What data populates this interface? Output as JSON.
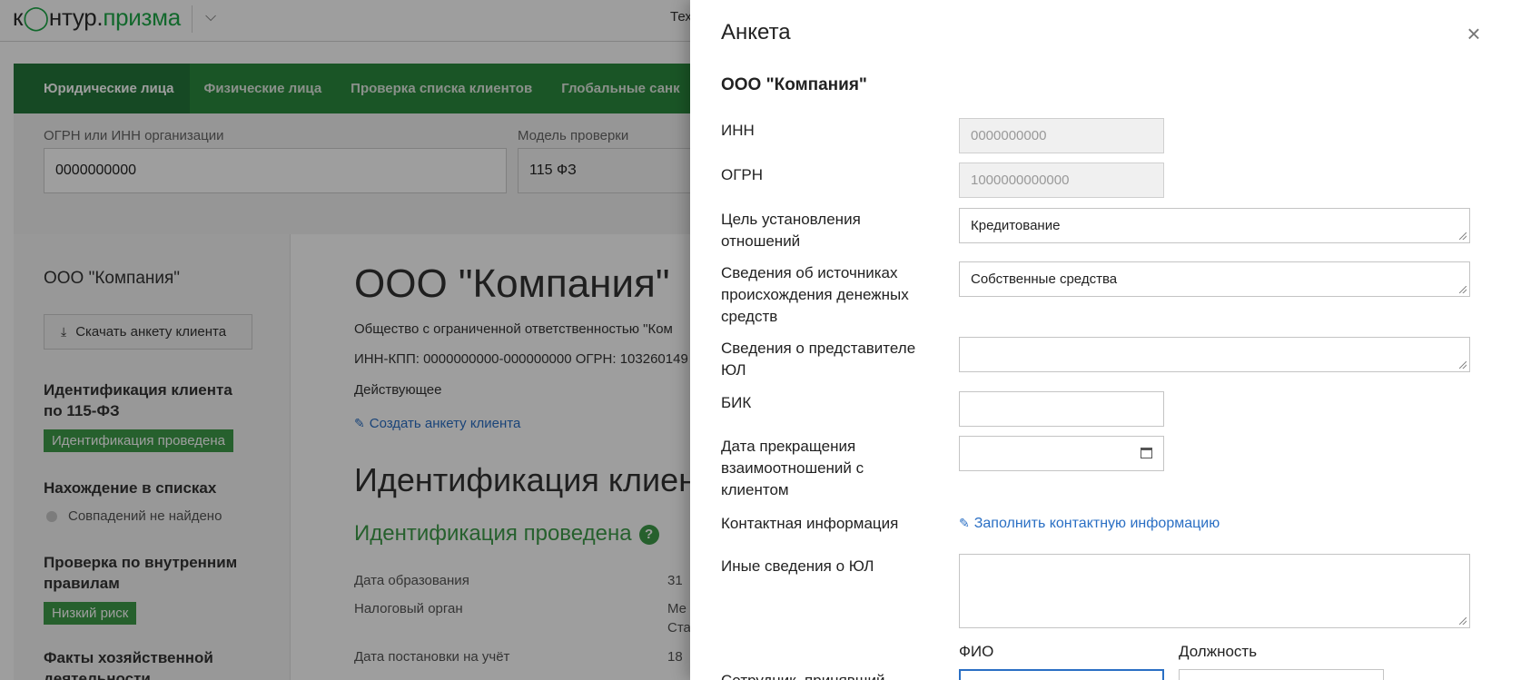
{
  "app": {
    "logo": {
      "part1": "к",
      "part2": "нтур.",
      "part3": "призма"
    },
    "header_text": "Тех",
    "tabs": [
      "Юридические лица",
      "Физические лица",
      "Проверка списка клиентов",
      "Глобальные санк"
    ],
    "search": {
      "ogrn_label": "ОГРН или ИНН организации",
      "ogrn_value": "0000000000",
      "model_label": "Модель проверки",
      "model_value": "115 ФЗ"
    },
    "sidebar": {
      "company": "ООО \"Компания\"",
      "download_button": "Скачать анкету клиента",
      "ident_heading": "Идентификация клиента по 115-ФЗ",
      "ident_badge": "Идентификация проведена",
      "lists_heading": "Нахождение в списках",
      "lists_status": "Совпадений не найдено",
      "rules_heading": "Проверка по внутренним правилам",
      "rules_badge": "Низкий риск",
      "facts_heading": "Факты хозяйственной деятельности"
    },
    "main": {
      "title": "ООО \"Компания\"",
      "full_name": "Общество с ограниченной ответственностью \"Ком",
      "inn_kpp": "ИНН-КПП: 0000000000-000000000 ОГРН: 103260149",
      "status": "Действующее",
      "create_link": "Создать анкету клиента",
      "section_title": "Идентификация клиен",
      "ident_status": "Идентификация проведена",
      "rows": [
        {
          "label": "Дата образования",
          "value": "31"
        },
        {
          "label": "Налоговый орган",
          "value": "Ме"
        },
        {
          "label": "",
          "value": "Ста"
        },
        {
          "label": "Дата постановки на учёт",
          "value": "18"
        }
      ]
    }
  },
  "panel": {
    "title": "Анкета",
    "company": "ООО \"Компания\"",
    "fields": {
      "inn": {
        "label": "ИНН",
        "value": "0000000000"
      },
      "ogrn": {
        "label": "ОГРН",
        "value": "1000000000000"
      },
      "purpose": {
        "label": "Цель установления отношений",
        "value": "Кредитование"
      },
      "funds": {
        "label": "Сведения об источниках происхождения денежных средств",
        "value": "Собственные средства"
      },
      "rep": {
        "label": "Сведения о представителе ЮЛ",
        "value": ""
      },
      "bik": {
        "label": "БИК",
        "value": ""
      },
      "end_date": {
        "label": "Дата прекращения взаимоотношений с клиентом",
        "value": ""
      },
      "contact": {
        "label": "Контактная информация",
        "link": "Заполнить контактную информацию"
      },
      "other": {
        "label": "Иные сведения о ЮЛ",
        "value": ""
      },
      "staff": {
        "label": "Сотрудник, принявший",
        "fio_head": "ФИО",
        "position_head": "Должность"
      }
    }
  }
}
